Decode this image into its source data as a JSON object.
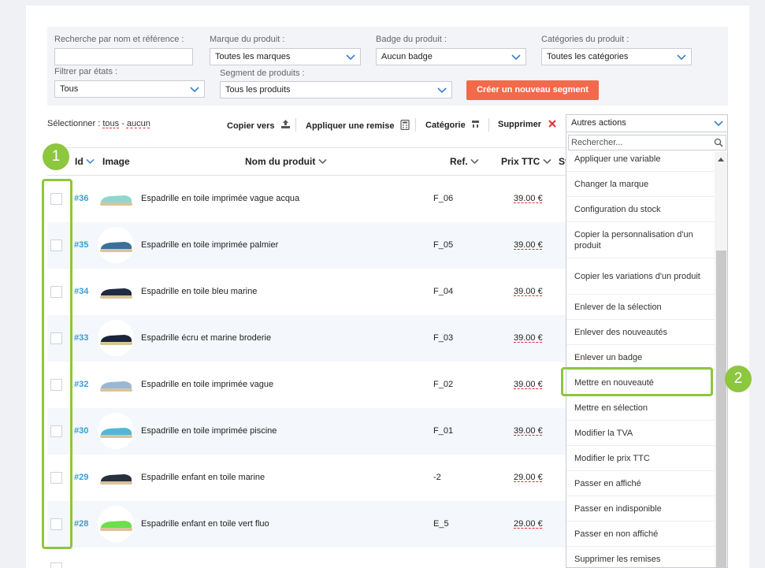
{
  "filters": {
    "search_label": "Recherche par nom et référence :",
    "search_value": "",
    "brand_label": "Marque du produit :",
    "brand_value": "Toutes les marques",
    "badge_label": "Badge du produit :",
    "badge_value": "Aucun badge",
    "category_label": "Catégories du produit :",
    "category_value": "Toutes les catégories",
    "state_label": "Filtrer par états :",
    "state_value": "Tous",
    "segment_label": "Segment de produits :",
    "segment_value": "Tous les produits",
    "create_segment_button": "Créer un nouveau segment"
  },
  "toolbar": {
    "select_label": "Sélectionner :",
    "select_all": "tous",
    "select_sep": "-",
    "select_none": "aucun",
    "copy_to": "Copier vers",
    "apply_discount": "Appliquer une remise",
    "category": "Catégorie",
    "delete": "Supprimer",
    "other_actions": "Autres actions"
  },
  "table": {
    "headers": {
      "id": "Id",
      "image": "Image",
      "name": "Nom du produit",
      "ref": "Ref.",
      "price": "Prix TTC",
      "status": "St"
    },
    "rows": [
      {
        "id": "#36",
        "name": "Espadrille en toile imprimée vague acqua",
        "ref": "F_06",
        "price": "39.00 €",
        "shoe_color": "#8fd6cf"
      },
      {
        "id": "#35",
        "name": "Espadrille en toile imprimée palmier",
        "ref": "F_05",
        "price": "39.00 €",
        "shoe_color": "#3d6f9c"
      },
      {
        "id": "#34",
        "name": "Espadrille en toile bleu marine",
        "ref": "F_04",
        "price": "39.00 €",
        "shoe_color": "#1f2a44"
      },
      {
        "id": "#33",
        "name": "Espadrille écru et marine broderie",
        "ref": "F_03",
        "price": "39.00 €",
        "shoe_color": "#1c2438"
      },
      {
        "id": "#32",
        "name": "Espadrille en toile imprimée vague",
        "ref": "F_02",
        "price": "39.00 €",
        "shoe_color": "#9ab8d6"
      },
      {
        "id": "#30",
        "name": "Espadrille en toile imprimée piscine",
        "ref": "F_01",
        "price": "39.00 €",
        "shoe_color": "#4fb8d8"
      },
      {
        "id": "#29",
        "name": "Espadrille enfant en toile marine",
        "ref": "-2",
        "price": "29.00 €",
        "shoe_color": "#2a2f3f"
      },
      {
        "id": "#28",
        "name": "Espadrille enfant en toile vert fluo",
        "ref": "E_5",
        "price": "29.00 €",
        "shoe_color": "#6be04a"
      }
    ]
  },
  "dropdown": {
    "search_placeholder": "Rechercher...",
    "items": [
      "Appliquer une variable",
      "Changer la marque",
      "Configuration du stock",
      "Copier la personnalisation d'un produit",
      "Copier les variations d'un produit",
      "Enlever de la sélection",
      "Enlever des nouveautés",
      "Enlever un badge",
      "Mettre en nouveauté",
      "Mettre en sélection",
      "Modifier la TVA",
      "Modifier le prix TTC",
      "Passer en affiché",
      "Passer en indisponible",
      "Passer en non affiché",
      "Supprimer les remises"
    ]
  },
  "annotations": {
    "badge_1": "1",
    "badge_2": "2",
    "highlight_color": "#8dc63f"
  },
  "colors": {
    "accent_orange": "#f26a4b",
    "link_blue": "#3a9bd6"
  }
}
